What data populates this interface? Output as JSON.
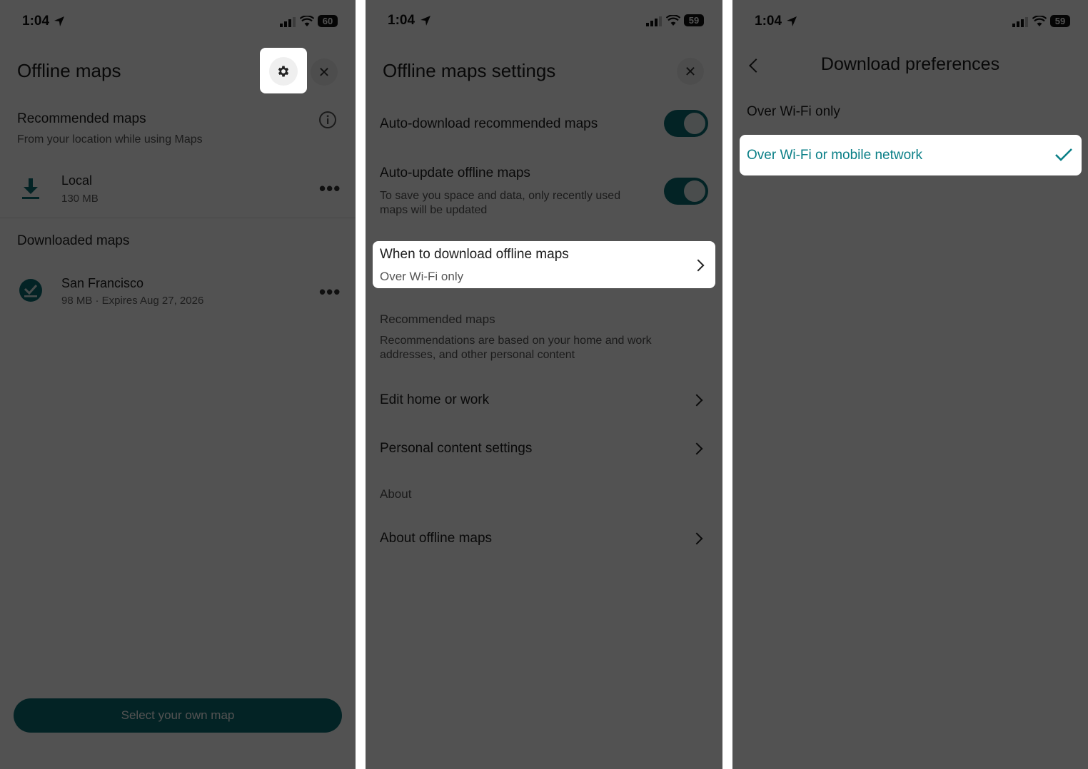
{
  "status_bar": {
    "time_left": "1:04",
    "battery_left": "60",
    "time_middle": "1:04",
    "battery_middle": "59",
    "time_right": "1:04",
    "battery_right": "59"
  },
  "panel1": {
    "title": "Offline maps",
    "recommended_heading": "Recommended maps",
    "recommended_sub": "From your location while using Maps",
    "local_name": "Local",
    "local_size": "130 MB",
    "downloaded_heading": "Downloaded maps",
    "sf_name": "San Francisco",
    "sf_details": "98 MB · Expires Aug 27, 2026",
    "select_button": "Select your own map"
  },
  "panel2": {
    "title": "Offline maps settings",
    "auto_download": "Auto-download recommended maps",
    "auto_update": "Auto-update offline maps",
    "auto_update_desc": "To save you space and data, only recently used maps will be updated",
    "when_download": "When to download offline maps",
    "when_download_value": "Over Wi-Fi only",
    "rec_heading": "Recommended maps",
    "rec_desc": "Recommendations are based on your home and work addresses, and other personal content",
    "edit_home": "Edit home or work",
    "personal_content": "Personal content settings",
    "about_heading": "About",
    "about_offline": "About offline maps"
  },
  "panel3": {
    "title": "Download preferences",
    "option_wifi": "Over Wi-Fi only",
    "option_mobile": "Over Wi-Fi or mobile network"
  },
  "colors": {
    "accent": "#0b6e73",
    "selected_text": "#0a7f87",
    "dim": "rgba(0,0,0,0.68)"
  }
}
